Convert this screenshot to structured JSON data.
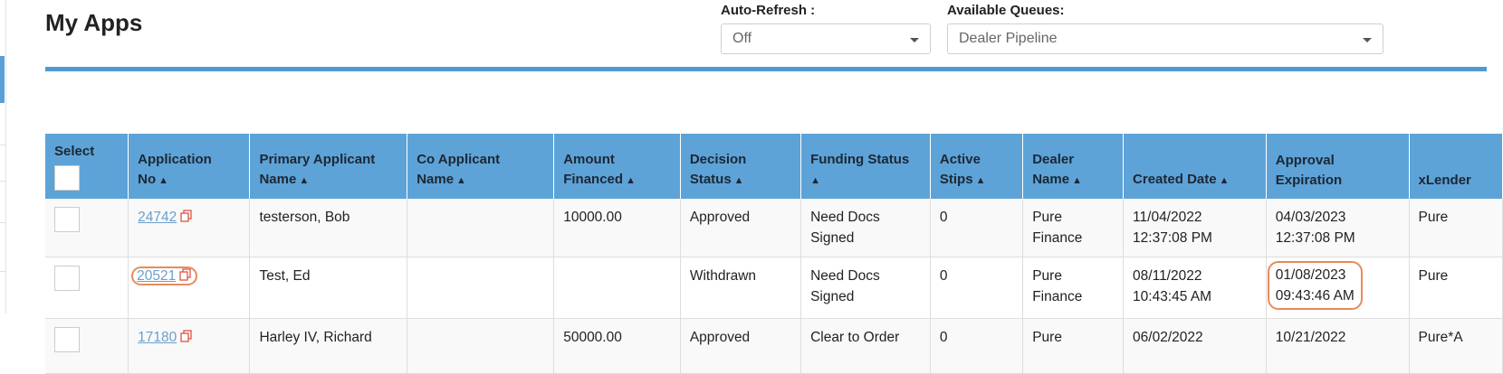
{
  "page": {
    "title": "My Apps"
  },
  "controls": {
    "auto_refresh": {
      "label": "Auto-Refresh :",
      "value": "Off"
    },
    "available_queues": {
      "label": "Available Queues:",
      "value": "Dealer Pipeline"
    }
  },
  "table": {
    "columns": [
      {
        "key": "select",
        "line1": "Select",
        "line2": ""
      },
      {
        "key": "application_no",
        "line1": "Application",
        "line2": "No"
      },
      {
        "key": "primary_applicant",
        "line1": "Primary Applicant",
        "line2": "Name"
      },
      {
        "key": "co_applicant",
        "line1": "Co Applicant",
        "line2": "Name"
      },
      {
        "key": "amount_financed",
        "line1": "Amount",
        "line2": "Financed"
      },
      {
        "key": "decision_status",
        "line1": "Decision",
        "line2": "Status"
      },
      {
        "key": "funding_status",
        "line1": "Funding Status",
        "line2": ""
      },
      {
        "key": "active_stips",
        "line1": "Active",
        "line2": "Stips"
      },
      {
        "key": "dealer_name",
        "line1": "Dealer",
        "line2": "Name"
      },
      {
        "key": "created_date",
        "line1": "",
        "line2": "Created Date"
      },
      {
        "key": "approval_expiration",
        "line1": "Approval",
        "line2": "Expiration"
      },
      {
        "key": "xlender",
        "line1": "",
        "line2": "xLender"
      }
    ],
    "rows": [
      {
        "application_no": "24742",
        "primary_applicant": "testerson, Bob",
        "co_applicant": "",
        "amount_financed": "10000.00",
        "decision_status": "Approved",
        "funding_status_1": "Need Docs",
        "funding_status_2": "Signed",
        "active_stips": "0",
        "dealer_name_1": "Pure",
        "dealer_name_2": "Finance",
        "created_date_1": "11/04/2022",
        "created_date_2": "12:37:08 PM",
        "approval_expiration_1": "04/03/2023",
        "approval_expiration_2": "12:37:08 PM",
        "xlender": "Pure"
      },
      {
        "application_no": "20521",
        "primary_applicant": "Test, Ed",
        "co_applicant": "",
        "amount_financed": "",
        "decision_status": "Withdrawn",
        "funding_status_1": "Need Docs",
        "funding_status_2": "Signed",
        "active_stips": "0",
        "dealer_name_1": "Pure",
        "dealer_name_2": "Finance",
        "created_date_1": "08/11/2022",
        "created_date_2": "10:43:45 AM",
        "approval_expiration_1": "01/08/2023",
        "approval_expiration_2": "09:43:46 AM",
        "xlender": "Pure"
      },
      {
        "application_no": "17180",
        "primary_applicant": "Harley IV, Richard",
        "co_applicant": "",
        "amount_financed": "50000.00",
        "decision_status": "Approved",
        "funding_status_1": "Clear to Order",
        "funding_status_2": "",
        "active_stips": "0",
        "dealer_name_1": "Pure",
        "dealer_name_2": "",
        "created_date_1": "06/02/2022",
        "created_date_2": "",
        "approval_expiration_1": "10/21/2022",
        "approval_expiration_2": "",
        "xlender": "Pure*A"
      }
    ]
  },
  "colors": {
    "header_bg": "#5da3d8",
    "rule": "#4f9ad3",
    "highlight": "#e98a5b",
    "link": "#6b9fcc",
    "copy_icon": "#e0533f"
  }
}
